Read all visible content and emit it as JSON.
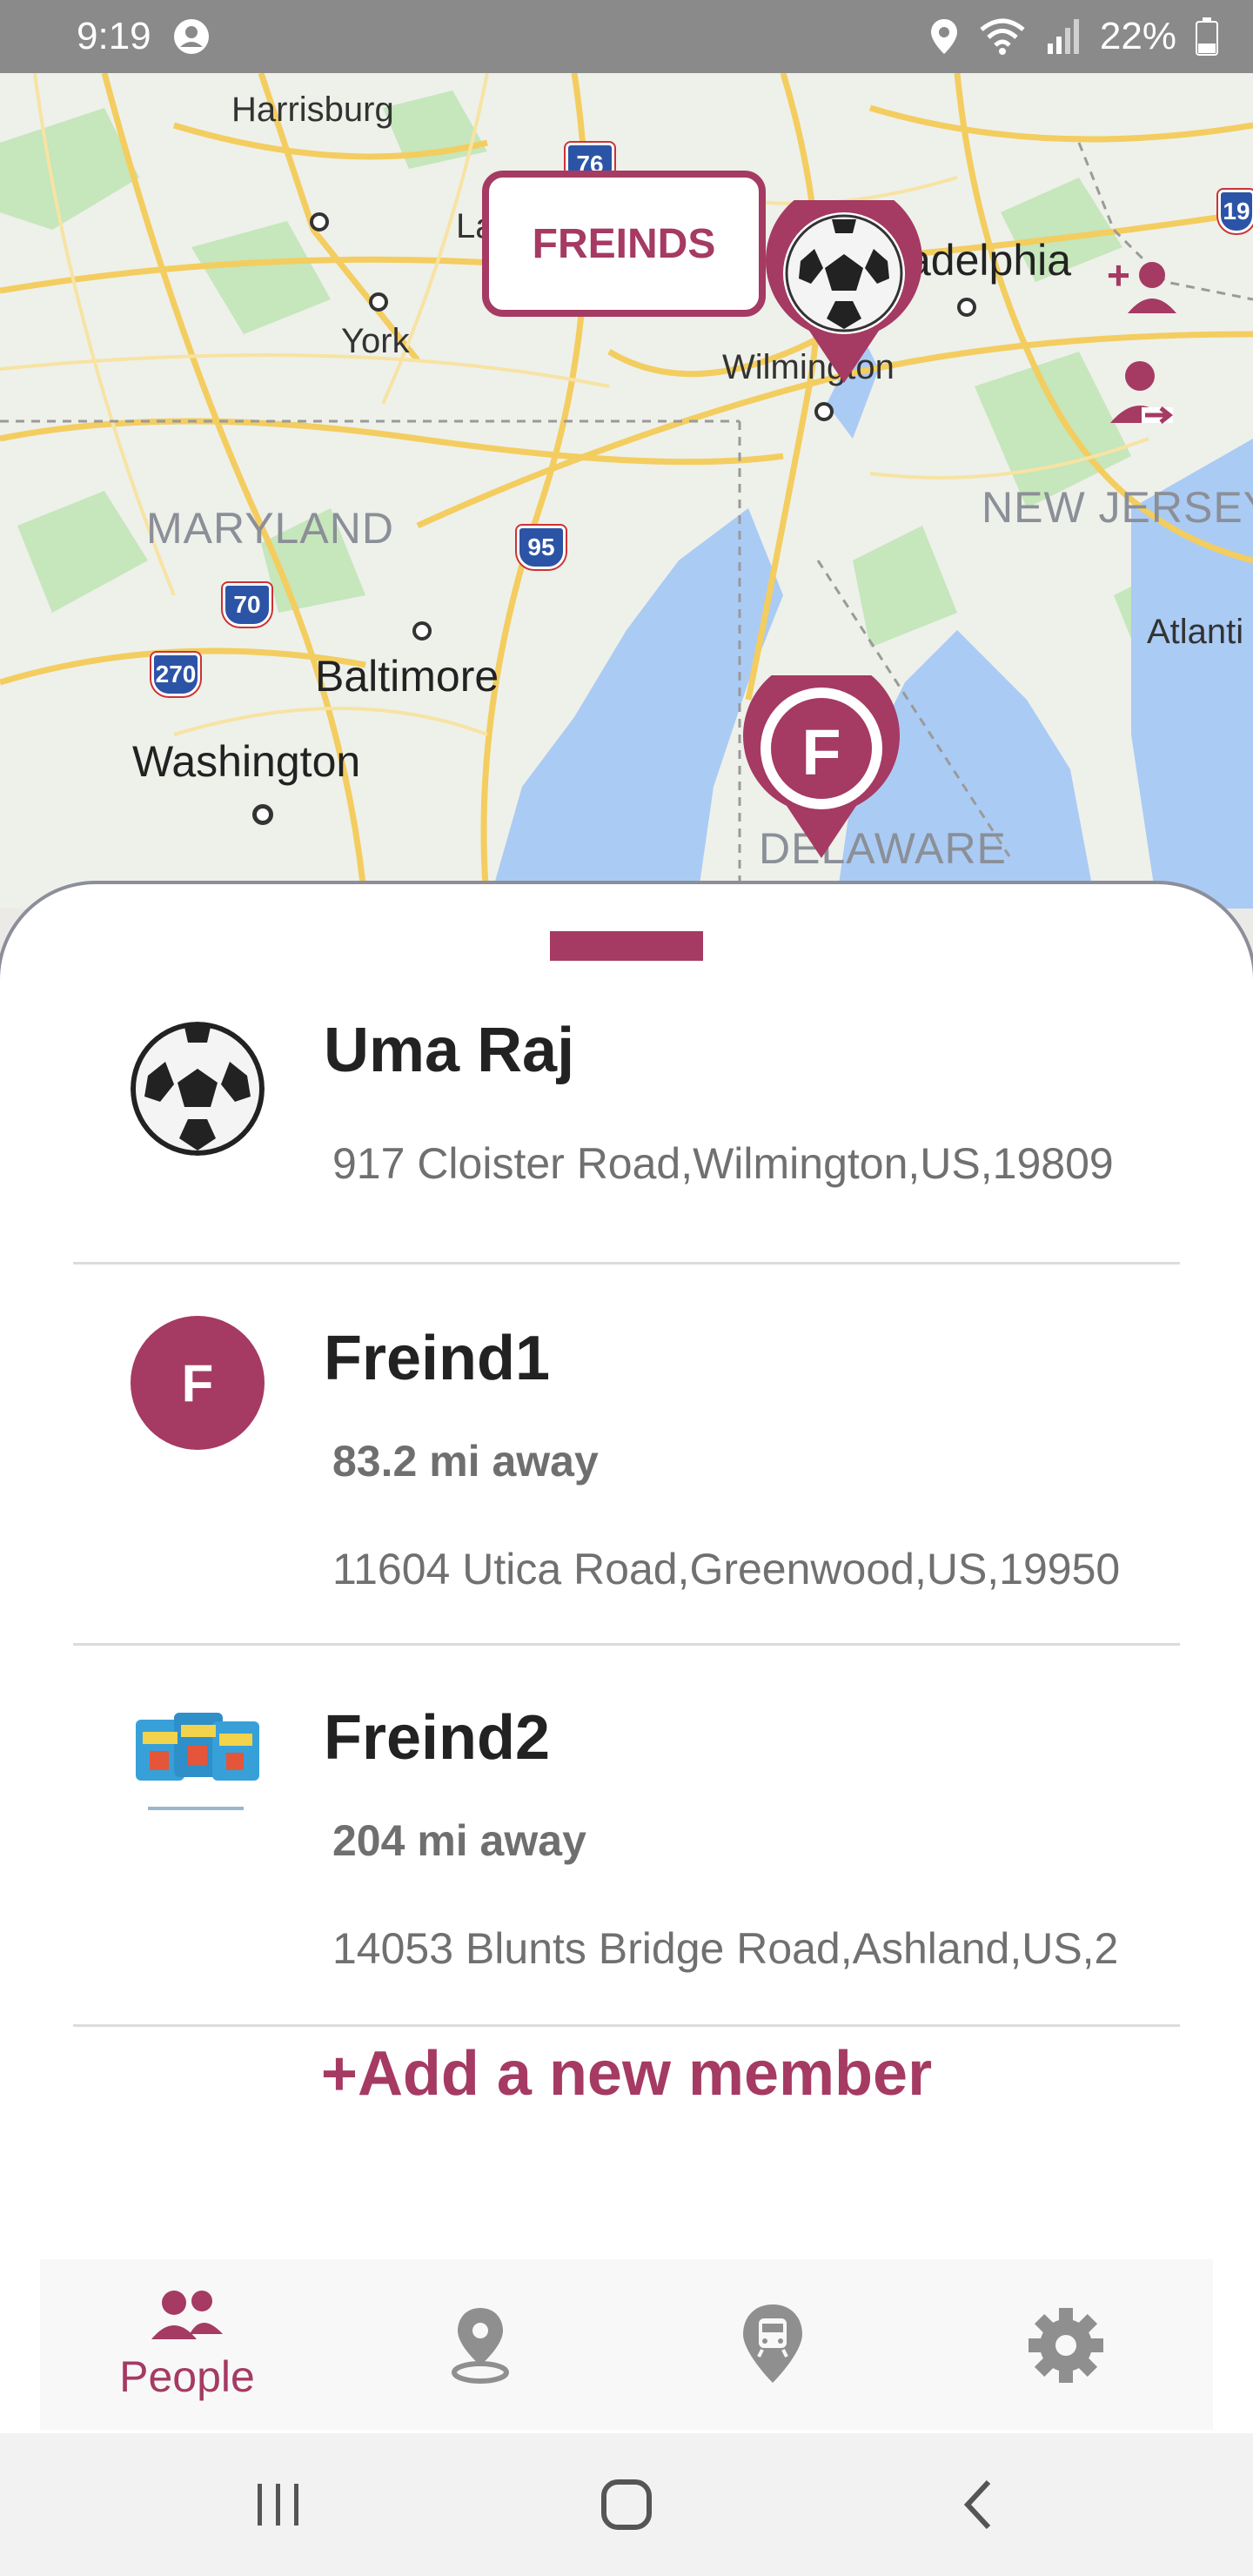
{
  "status_bar": {
    "time": "9:19",
    "battery": "22%",
    "icons": [
      "account-circle-icon",
      "location-icon",
      "wifi-icon",
      "signal-icon",
      "battery-icon"
    ]
  },
  "map": {
    "labels": {
      "harrisburg": "Harrisburg",
      "lancaster": "La",
      "york": "York",
      "philadelphia": "adelphia",
      "wilmington": "Wilmington",
      "maryland": "MARYLAND",
      "new_jersey": "NEW JERSEY",
      "baltimore": "Baltimore",
      "washington": "Washington",
      "atlantic": "Atlanti",
      "delaware": "DELAWARE"
    },
    "highway_shields": [
      "76",
      "95",
      "70",
      "270",
      "19"
    ],
    "callout": "FREINDS",
    "pin_letter": "F",
    "icons": [
      "add-person-icon",
      "person-exit-icon",
      "soccer-ball-pin-icon",
      "letter-pin-icon"
    ]
  },
  "members": [
    {
      "name": "Uma  Raj",
      "address": "917 Cloister Road,Wilmington,US,19809",
      "avatar_icon": "soccer-ball-icon"
    },
    {
      "name": "Freind1",
      "distance": "83.2 mi  away",
      "address": "11604 Utica Road,Greenwood,US,19950",
      "avatar_letter": "F"
    },
    {
      "name": "Freind2",
      "distance": "204 mi  away",
      "address": "14053 Blunts Bridge Road,Ashland,US,2",
      "avatar_icon": "product-photo-icon"
    }
  ],
  "add_member_label": "+Add a new member",
  "bottom_nav": {
    "items": [
      {
        "label": "People",
        "icon": "people-icon",
        "active": true
      },
      {
        "label": "",
        "icon": "place-pin-icon"
      },
      {
        "label": "",
        "icon": "transit-icon"
      },
      {
        "label": "",
        "icon": "gear-icon"
      }
    ]
  },
  "colors": {
    "accent": "#a53a63",
    "status_bar": "#8a8a8a",
    "water": "#aacbf4",
    "road": "#f6d36a",
    "park": "#bfe3b4"
  }
}
